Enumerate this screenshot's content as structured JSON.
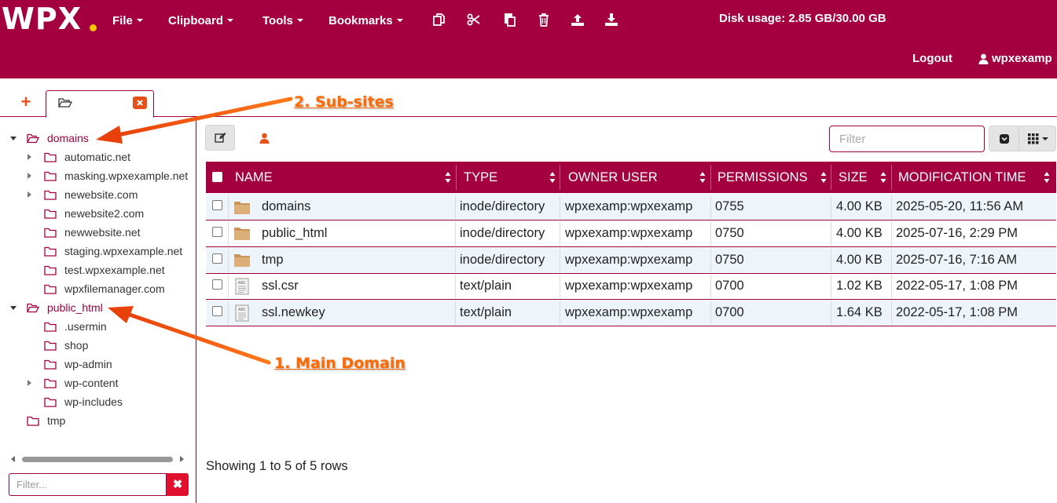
{
  "header": {
    "logo": "WPX",
    "menus": [
      {
        "label": "File"
      },
      {
        "label": "Clipboard"
      },
      {
        "label": "Tools"
      },
      {
        "label": "Bookmarks"
      }
    ],
    "toolbar_icons": [
      "copy-icon",
      "cut-icon",
      "paste-icon",
      "trash-icon",
      "upload-icon",
      "download-icon"
    ],
    "disk_usage": "Disk usage: 2.85 GB/30.00 GB",
    "logout": "Logout",
    "username": "wpxexamp"
  },
  "tabs": {
    "add_icon": "plus-icon",
    "active_tab_icon": "folder-open-icon",
    "close_icon": "close-icon"
  },
  "annotations": {
    "sub_sites": "2. Sub-sites",
    "main_domain": "1. Main Domain"
  },
  "tree": {
    "items": [
      {
        "label": "domains",
        "level": 0,
        "expand": "down",
        "selected": true
      },
      {
        "label": "automatic.net",
        "level": 1,
        "expand": "right"
      },
      {
        "label": "masking.wpxexample.net",
        "level": 1,
        "expand": "right"
      },
      {
        "label": "newebsite.com",
        "level": 1,
        "expand": "right"
      },
      {
        "label": "newebsite2.com",
        "level": 1,
        "expand": "none"
      },
      {
        "label": "newwebsite.net",
        "level": 1,
        "expand": "none"
      },
      {
        "label": "staging.wpxexample.net",
        "level": 1,
        "expand": "none"
      },
      {
        "label": "test.wpxexample.net",
        "level": 1,
        "expand": "none"
      },
      {
        "label": "wpxfilemanager.com",
        "level": 1,
        "expand": "none"
      },
      {
        "label": "public_html",
        "level": 0,
        "expand": "down",
        "selected": true
      },
      {
        "label": ".usermin",
        "level": 1,
        "expand": "none"
      },
      {
        "label": "shop",
        "level": 1,
        "expand": "none"
      },
      {
        "label": "wp-admin",
        "level": 1,
        "expand": "none"
      },
      {
        "label": "wp-content",
        "level": 1,
        "expand": "right"
      },
      {
        "label": "wp-includes",
        "level": 1,
        "expand": "none"
      },
      {
        "label": "tmp",
        "level": 0,
        "expand": "none"
      }
    ],
    "filter_placeholder": "Filter...",
    "filter_clear": "✖"
  },
  "main": {
    "filter_placeholder": "Filter",
    "columns": [
      "NAME",
      "TYPE",
      "OWNER USER",
      "PERMISSIONS",
      "SIZE",
      "MODIFICATION TIME"
    ],
    "rows": [
      {
        "name": "domains",
        "icon": "folder",
        "type": "inode/directory",
        "owner": "wpxexamp:wpxexamp",
        "perms": "0755",
        "size": "4.00 KB",
        "mtime": "2025-05-20, 11:56 AM"
      },
      {
        "name": "public_html",
        "icon": "folder",
        "type": "inode/directory",
        "owner": "wpxexamp:wpxexamp",
        "perms": "0750",
        "size": "4.00 KB",
        "mtime": "2025-07-16, 2:29 PM"
      },
      {
        "name": "tmp",
        "icon": "folder",
        "type": "inode/directory",
        "owner": "wpxexamp:wpxexamp",
        "perms": "0750",
        "size": "4.00 KB",
        "mtime": "2025-07-16, 7:16 AM"
      },
      {
        "name": "ssl.csr",
        "icon": "text-file",
        "type": "text/plain",
        "owner": "wpxexamp:wpxexamp",
        "perms": "0700",
        "size": "1.02 KB",
        "mtime": "2022-05-17, 1:08 PM"
      },
      {
        "name": "ssl.newkey",
        "icon": "text-file",
        "type": "text/plain",
        "owner": "wpxexamp:wpxexamp",
        "perms": "0700",
        "size": "1.64 KB",
        "mtime": "2022-05-17, 1:08 PM"
      }
    ],
    "footer": "Showing 1 to 5 of 5 rows"
  },
  "colors": {
    "brand": "#a4003f",
    "accent": "#e8501a",
    "logo_dot": "#f6c400",
    "annotation": "#ff6a00",
    "row_alt": "#eef5fa"
  }
}
